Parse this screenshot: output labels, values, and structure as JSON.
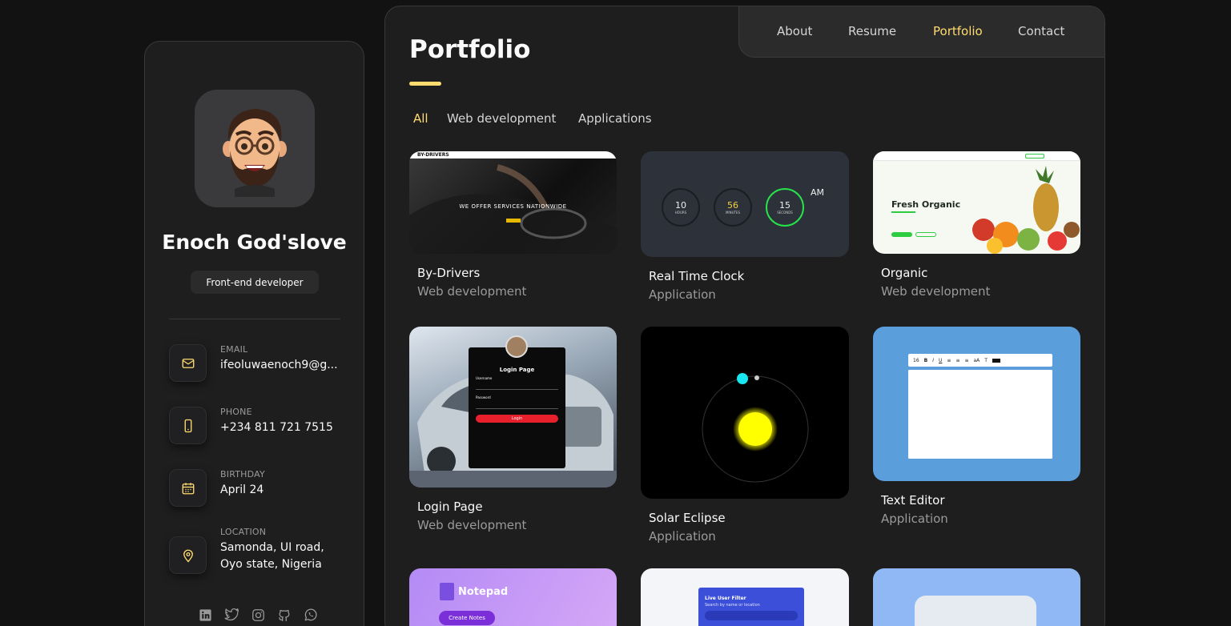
{
  "profile": {
    "name": "Enoch God'slove",
    "title": "Front-end developer"
  },
  "contacts": [
    {
      "label": "EMAIL",
      "value": "ifeoluwaenoch9@g...",
      "icon": "mail-icon"
    },
    {
      "label": "PHONE",
      "value": "+234 811 721 7515",
      "icon": "phone-icon"
    },
    {
      "label": "BIRTHDAY",
      "value": "April 24",
      "icon": "calendar-icon"
    },
    {
      "label": "LOCATION",
      "value_line1": "Samonda, UI road,",
      "value_line2": "Oyo state, Nigeria",
      "icon": "location-pin-icon"
    }
  ],
  "socials": [
    "linkedin-icon",
    "twitter-icon",
    "instagram-icon",
    "github-icon",
    "whatsapp-icon"
  ],
  "nav": {
    "items": [
      {
        "label": "About"
      },
      {
        "label": "Resume"
      },
      {
        "label": "Portfolio",
        "active": true
      },
      {
        "label": "Contact"
      }
    ]
  },
  "page": {
    "title": "Portfolio"
  },
  "filters": [
    {
      "label": "All",
      "active": true
    },
    {
      "label": "Web development"
    },
    {
      "label": "Applications"
    }
  ],
  "projects": [
    {
      "title": "By-Drivers",
      "category": "Web development",
      "thumb_text": "WE OFFER SERVICES NATIONWIDE",
      "brand": "BY-DRIVERS"
    },
    {
      "title": "Real Time Clock",
      "category": "Application",
      "clock": {
        "hours": "10",
        "minutes": "56",
        "seconds": "15",
        "period": "AM",
        "hours_label": "HOURS",
        "minutes_label": "MINUTES",
        "seconds_label": "SECONDS"
      }
    },
    {
      "title": "Organic",
      "category": "Web development",
      "thumb_text": "Fresh Organic"
    },
    {
      "title": "Login Page",
      "category": "Web development",
      "thumb_text": "Login Page",
      "login": {
        "username": "Username",
        "password": "Password",
        "button": "Login"
      }
    },
    {
      "title": "Solar Eclipse",
      "category": "Application"
    },
    {
      "title": "Text Editor",
      "category": "Application",
      "editor_size": "16"
    },
    {
      "title": "Notepad",
      "category": "",
      "thumb_text": "Notepad",
      "button": "Create Notes"
    },
    {
      "title": "Live User Filter",
      "category": "",
      "thumb_text": "Live User Filter",
      "subtext": "Search by name or location"
    },
    {
      "title": "",
      "category": ""
    }
  ],
  "colors": {
    "accent": "#ffdb70",
    "background": "#121212",
    "panel": "#1e1e1f",
    "text_muted": "#9a9a9a"
  }
}
